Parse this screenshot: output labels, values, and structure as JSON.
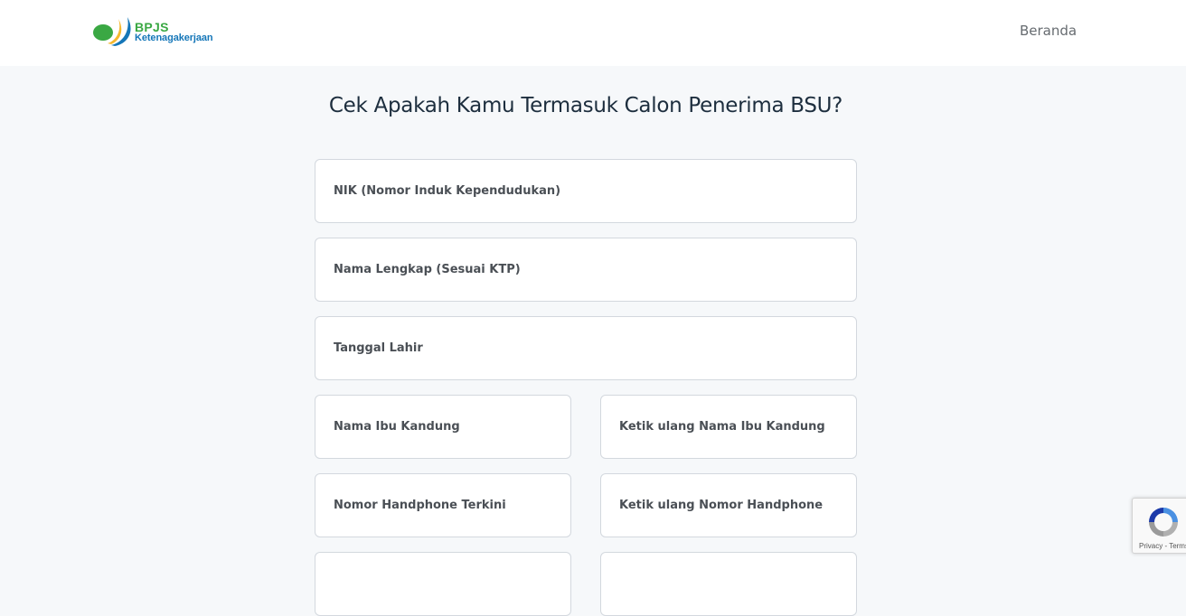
{
  "brand": {
    "name": "BPJS",
    "subtitle": "Ketenagakerjaan"
  },
  "nav": {
    "home_label": "Beranda"
  },
  "form": {
    "title": "Cek Apakah Kamu Termasuk Calon Penerima BSU?",
    "fields": {
      "nik": "NIK (Nomor Induk Kependudukan)",
      "full_name": "Nama Lengkap (Sesuai KTP)",
      "birth_date": "Tanggal Lahir",
      "mother_name": "Nama Ibu Kandung",
      "mother_name_confirm": "Ketik ulang Nama Ibu Kandung",
      "phone": "Nomor Handphone Terkini",
      "phone_confirm": "Ketik ulang Nomor Handphone"
    }
  },
  "recaptcha": {
    "links": "Privacy - Terms"
  },
  "colors": {
    "brand_green": "#3aa843",
    "brand_blue": "#1476b8",
    "page_bg": "#f6f8fa",
    "field_border": "#d3d8de",
    "title_text": "#1d2e3e"
  }
}
